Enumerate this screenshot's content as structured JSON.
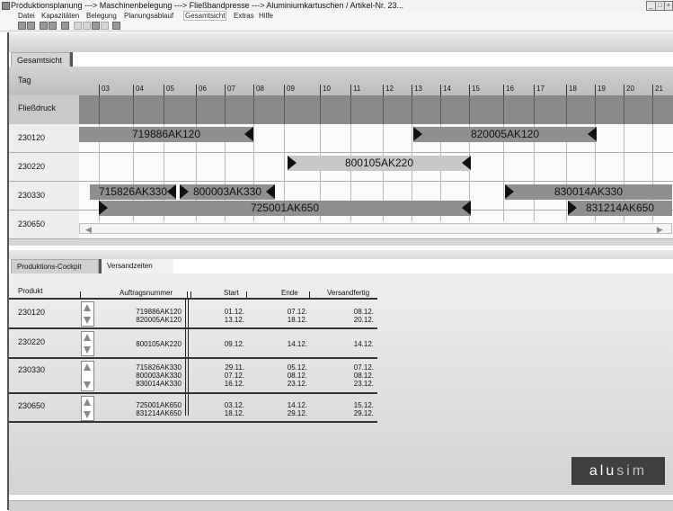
{
  "window": {
    "title": "Produktionsplanung ---> Maschinenbelegung ---> Fließbandpresse ---> Aluminiumkartuschen / Artikel-Nr. 23..."
  },
  "menu": [
    "Datei",
    "Kapazitäten",
    "Belegung",
    "Planungsablauf",
    "Gesamtsicht",
    "Extras",
    "Hilfe"
  ],
  "menu_active": "Gesamtsicht",
  "toolbar_icons": [
    "new-icon",
    "save-icon",
    "print-icon",
    "preview-icon",
    "find-icon",
    "cut-icon",
    "copy-icon",
    "paste-icon",
    "undo-icon",
    "format-icon"
  ],
  "gantt": {
    "tab": "Gesamtsicht",
    "tag_label": "Tag",
    "days": [
      "03",
      "04",
      "05",
      "06",
      "07",
      "08",
      "09",
      "10",
      "11",
      "12",
      "13",
      "14",
      "15",
      "16",
      "17",
      "18",
      "19",
      "20",
      "21"
    ],
    "machine_row": "Fließdruck",
    "rows": [
      {
        "product": "230120",
        "orders": [
          "719886AK120",
          "820005AK120"
        ]
      },
      {
        "product": "230220",
        "orders": [
          "800105AK220"
        ]
      },
      {
        "product": "230330",
        "orders": [
          "715826AK330",
          "800003AK330",
          "830014AK330"
        ]
      },
      {
        "product": "230650",
        "orders": [
          "725001AK650",
          "831214AK650"
        ]
      }
    ]
  },
  "cockpit": {
    "tabs": [
      "Produktions-Cockpit",
      "Versandzeiten"
    ],
    "headers": {
      "produkt": "Produkt",
      "auftrag": "Auftragsnummer",
      "start": "Start",
      "ende": "Ende",
      "versand": "Versandfertig"
    },
    "rows": [
      {
        "product": "230120",
        "auftraege": "719886AK120\n820005AK120",
        "start": "01.12.\n13.12.",
        "ende": "07.12.\n18.12.",
        "versand": "08.12.\n20.12."
      },
      {
        "product": "230220",
        "auftraege": "800105AK220",
        "start": "09.12.",
        "ende": "14.12.",
        "versand": "14.12."
      },
      {
        "product": "230330",
        "auftraege": "715826AK330\n800003AK330\n830014AK330",
        "start": "29.11.\n07.12.\n16.12.",
        "ende": "05.12.\n08.12.\n23.12.",
        "versand": "07.12.\n08.12.\n23.12."
      },
      {
        "product": "230650",
        "auftraege": "725001AK650\n831214AK650",
        "start": "03.12.\n18.12.",
        "ende": "14.12.\n29.12.",
        "versand": "15.12.\n29.12."
      }
    ]
  },
  "logo": {
    "part1": "alu",
    "part2": "sim"
  }
}
